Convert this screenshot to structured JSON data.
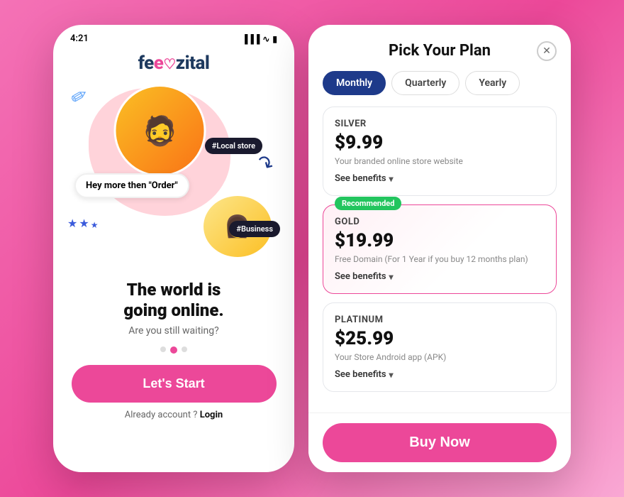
{
  "left": {
    "status_time": "4:21",
    "logo": "feezital",
    "local_tag": "#Local store",
    "speech_text": "Hey more then \"Order\"",
    "business_tag": "#Business",
    "tagline_line1": "The world is",
    "tagline_line2": "going online.",
    "sub_tagline": "Are you still waiting?",
    "btn_start": "Let's Start",
    "already_text": "Already account ?",
    "login_text": "Login"
  },
  "right": {
    "title": "Pick Your Plan",
    "tabs": [
      {
        "label": "Monthly",
        "active": true
      },
      {
        "label": "Quarterly",
        "active": false
      },
      {
        "label": "Yearly",
        "active": false
      }
    ],
    "close_icon": "✕",
    "plans": [
      {
        "name": "SILVER",
        "price": "$9.99",
        "desc": "Your branded online store website",
        "see_benefits": "See benefits",
        "recommended": false
      },
      {
        "name": "GOLD",
        "price": "$19.99",
        "desc": "Free Domain (For 1 Year if you buy 12 months plan)",
        "see_benefits": "See benefits",
        "recommended": true,
        "badge": "Recommended"
      },
      {
        "name": "PLATINUM",
        "price": "$25.99",
        "desc": "Your Store Android app (APK)",
        "see_benefits": "See benefits",
        "recommended": false
      }
    ],
    "buy_btn": "Buy Now"
  }
}
